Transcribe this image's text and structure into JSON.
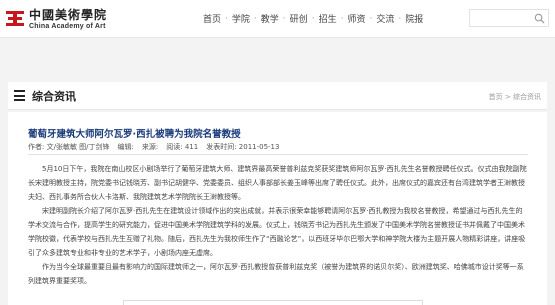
{
  "header": {
    "logo_cn": "中國美術學院",
    "logo_en": "China Academy of Art",
    "nav": [
      "首页",
      "学院",
      "教学",
      "研创",
      "招生",
      "师资",
      "交流",
      "院报"
    ],
    "nav_separator": "·",
    "search_placeholder": ""
  },
  "section": {
    "title": "综合资讯",
    "breadcrumb": "首页 > 综合资讯"
  },
  "article": {
    "title": "葡萄牙建筑大师阿尔瓦罗·西扎被聘为我院名誉教授",
    "meta": {
      "author": "作者: 文/张敏敏  图/丁剑锋",
      "editor": "编辑:",
      "source": "来源:",
      "views": "阅读: 411",
      "date": "发表时间: 2011-05-13"
    },
    "paragraphs": [
      "5月10日下午，我院在南山校区小剧场举行了葡萄牙建筑大师、建筑界最高荣誉普利兹克奖获奖建筑师阿尔瓦罗·西扎先生名誉教授聘任仪式。仪式由我院副院长宋建明教授主持，院党委书记钱晓芳、副书记胡健华、党委委员、组织人事部部长姜玉峰等出席了聘任仪式。此外，出席仪式的嘉宾还有台湾建筑学者王澍教授夫妇、西扎事务所合伙人卡洛斯、我院建筑艺术学院院长王澍教授等。",
      "宋建明副院长介绍了阿尔瓦罗·西扎先生在建筑设计领域作出的突出成就，并表示很荣幸能够聘请阿尔瓦罗·西扎教授为我校名誉教授，希望通过与西扎先生的学术交流与合作，提高学生的研究能力，促进中国美术学院建筑学科的发展。仪式上，钱晓芳书记为西扎先生颁发了中国美术学院名誉教授证书并佩戴了中国美术学院校徽，代表学校与西扎先生互赠了礼物。随后，西扎先生为我校师生作了“西融论艺”，以西班牙毕尔巴鄂大学和神学院大楼为主题开展人物精彩讲座，讲座吸引了众多建筑专业和非专业的艺术学子，小剧场内座无虚席。",
      "作为当今全球最重要且最有影响力的国际建筑师之一，阿尔瓦罗·西扎教授曾获普利兹克奖（被誉为建筑界的诺贝尔奖）、欧洲建筑奖、哈佛城市设计奖等一系列建筑界重要奖项。"
    ]
  }
}
